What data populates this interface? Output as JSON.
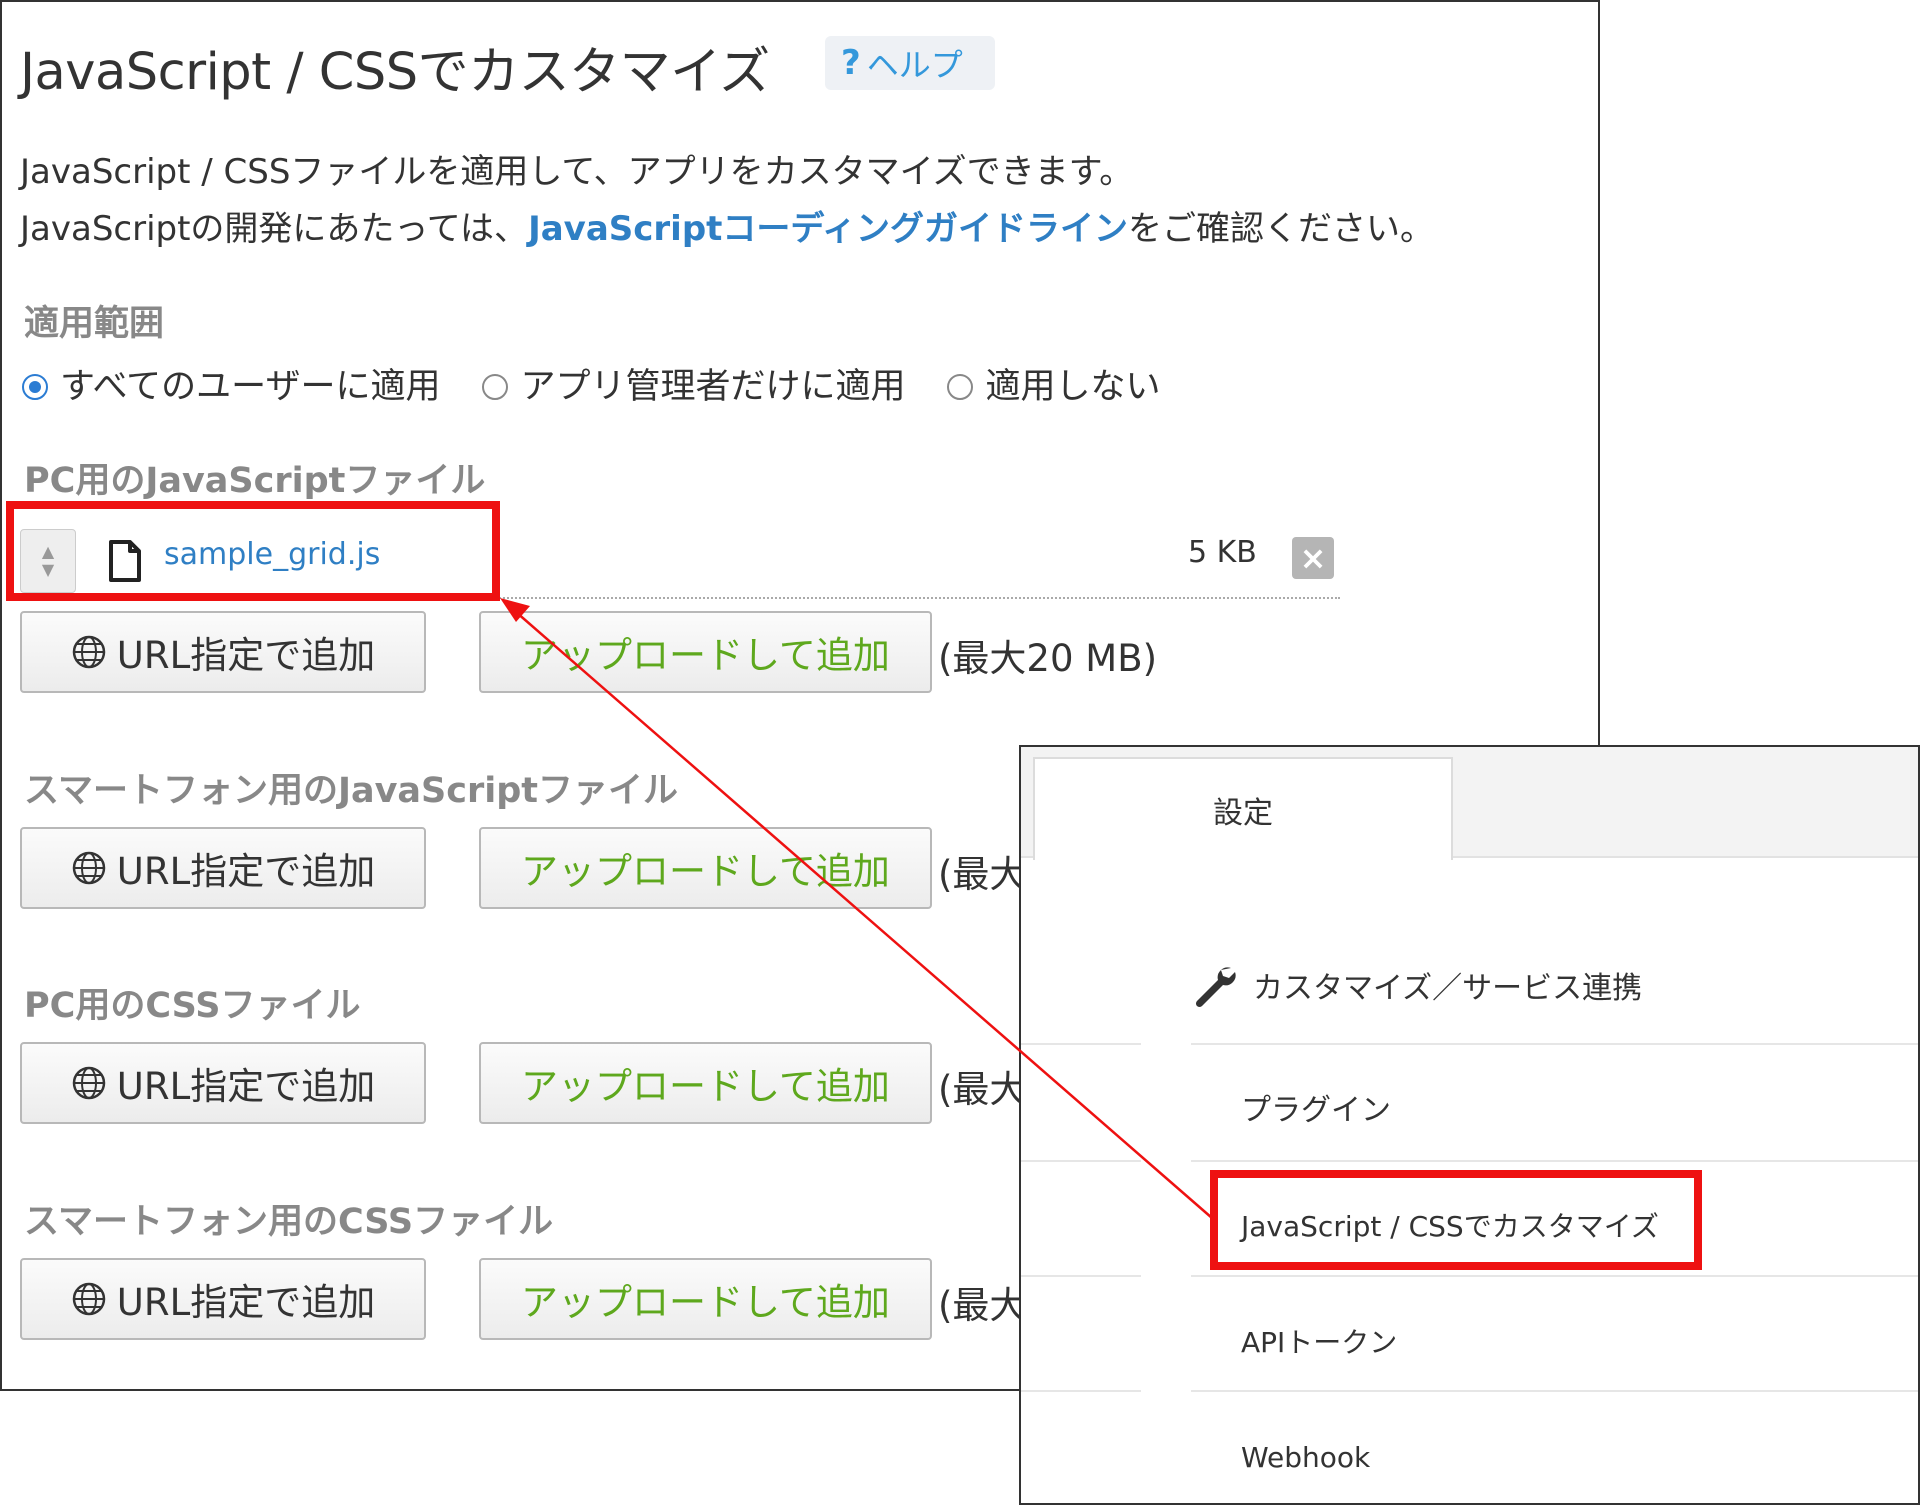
{
  "main": {
    "title": "JavaScript / CSSでカスタマイズ",
    "help_label": "ヘルプ",
    "help_q": "?",
    "description_line1": "JavaScript / CSSファイルを適用して、アプリをカスタマイズできます。",
    "description_line2_pre": "JavaScriptの開発にあたっては、",
    "description_line2_link": "JavaScriptコーディングガイドライン",
    "description_line2_post": "をご確認ください。",
    "scope_label": "適用範囲",
    "scope_options": [
      {
        "label": "すべてのユーザーに適用",
        "selected": true
      },
      {
        "label": "アプリ管理者だけに適用",
        "selected": false
      },
      {
        "label": "適用しない",
        "selected": false
      }
    ],
    "sections": [
      {
        "label": "PC用のJavaScriptファイル",
        "max_note": "(最大20 MB)"
      },
      {
        "label": "スマートフォン用のJavaScriptファイル",
        "max_note": "(最大"
      },
      {
        "label": "PC用のCSSファイル",
        "max_note": "(最大"
      },
      {
        "label": "スマートフォン用のCSSファイル",
        "max_note": "(最大"
      }
    ],
    "file": {
      "name": "sample_grid.js",
      "size": "5 KB",
      "remove_icon": "×"
    },
    "url_button_label": "URL指定で追加",
    "upload_button_label": "アップロードして追加"
  },
  "settings_inset": {
    "tab_label": "設定",
    "menu": [
      {
        "label": "カスタマイズ／サービス連携",
        "icon": "wrench-icon"
      },
      {
        "label": "プラグイン"
      },
      {
        "label": "JavaScript / CSSでカスタマイズ"
      },
      {
        "label": "APIトークン"
      },
      {
        "label": "Webhook"
      }
    ]
  },
  "colors": {
    "highlight": "#ee1111",
    "link": "#2f7fc4",
    "upload_text": "#5ea81d",
    "radio_selected": "#2b7cd3"
  }
}
